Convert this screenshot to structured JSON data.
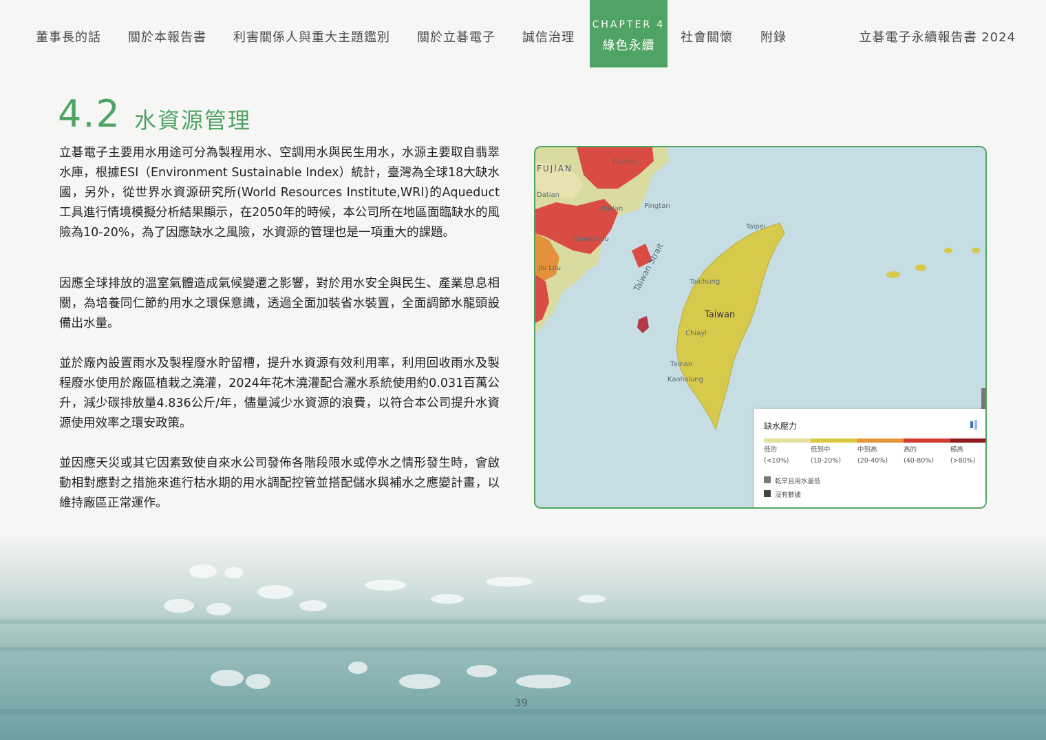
{
  "nav": {
    "items": [
      {
        "id": "chairman",
        "label": "董事長的話"
      },
      {
        "id": "about-report",
        "label": "關於本報告書"
      },
      {
        "id": "stakeholders",
        "label": "利害關係人與重大主題鑑別"
      },
      {
        "id": "about-company",
        "label": "關於立碁電子"
      },
      {
        "id": "governance",
        "label": "誠信治理"
      },
      {
        "id": "social",
        "label": "社會關懷"
      },
      {
        "id": "appendix",
        "label": "附錄"
      }
    ],
    "active_chapter": {
      "chapter": "CHAPTER 4",
      "title": "綠色永續"
    },
    "report_title": "立碁電子永續報告書 2024"
  },
  "section": {
    "number": "4.2",
    "title": "水資源管理"
  },
  "paragraphs": [
    "立碁電子主要用水用途可分為製程用水、空調用水與民生用水，水源主要取自翡翠水庫，根據ESI（Environment Sustainable Index）統計，臺灣為全球18大缺水國，另外，從世界水資源研究所(World Resources Institute,WRI)的Aqueduct工具進行情境模擬分析結果顯示，在2050年的時候，本公司所在地區面臨缺水的風險為10-20%，為了因應缺水之風險，水資源的管理也是一項重大的課題。",
    "因應全球排放的溫室氣體造成氣候變遷之影響，對於用水安全與民生、產業息息相關，為培養同仁節約用水之環保意識，透過全面加裝省水裝置，全面調節水龍頭設備出水量。",
    "並於廠內設置雨水及製程廢水貯留槽，提升水資源有效利用率，利用回收雨水及製程廢水使用於廠區植栽之澆灌，2024年花木澆灌配合灑水系統使用約0.031百萬公升，減少碳排放量4.836公斤/年，儘量減少水資源的浪費，以符合本公司提升水資源使用效率之環安政策。",
    "並因應天災或其它因素致使自來水公司發佈各階段限水或停水之情形發生時，會啟動相對應對之措施來進行枯水期的用水調配控管並搭配儲水與補水之應變計畫，以維持廠區正常運作。"
  ],
  "map": {
    "labels": {
      "fujian": "FUJIAN",
      "fuzhou": "Fuzhou",
      "datian": "Datian",
      "putian": "Putian",
      "pingtan": "Pingtan",
      "quanzhou": "Quanzhou",
      "jiulong": "Jiu Lou",
      "strait": "Taiwan Strait",
      "taipei": "Taipei",
      "taichung": "Taichung",
      "taiwan": "Taiwan",
      "chiayi": "Chiayi",
      "tainan": "Tainan",
      "kaohsiung": "Kaohsiung"
    },
    "legend": {
      "title": "缺水壓力",
      "levels": [
        {
          "name": "低的",
          "range": "(<10%)",
          "color": "#e6e0a0"
        },
        {
          "name": "低到中",
          "range": "(10-20%)",
          "color": "#dcc93f"
        },
        {
          "name": "中到高",
          "range": "(20-40%)",
          "color": "#e5953a"
        },
        {
          "name": "高的",
          "range": "(40-80%)",
          "color": "#d33a33"
        },
        {
          "name": "極高",
          "range": "(>80%)",
          "color": "#8e1c1f"
        }
      ],
      "notes": [
        {
          "label": "乾旱且用水量低",
          "color": "#777777"
        },
        {
          "label": "沒有數據",
          "color": "#444444"
        }
      ]
    }
  },
  "page_number": "39",
  "colors": {
    "accent": "#4fa463"
  }
}
